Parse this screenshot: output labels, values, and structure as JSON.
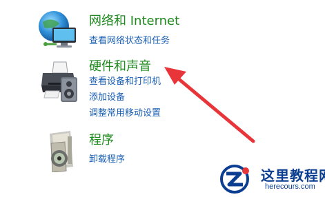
{
  "categories": [
    {
      "title": "网络和 Internet",
      "links": [
        "查看网络状态和任务"
      ],
      "icon": "network-globe-icon"
    },
    {
      "title": "硬件和声音",
      "links": [
        "查看设备和打印机",
        "添加设备",
        "调整常用移动设置"
      ],
      "icon": "printer-icon"
    },
    {
      "title": "程序",
      "links": [
        "卸载程序"
      ],
      "icon": "programs-disc-icon"
    }
  ],
  "annotation": {
    "color": "#e8353a"
  },
  "watermark": {
    "title": "这里教程网",
    "url": "herecours.com",
    "color": "#0b3d91"
  }
}
